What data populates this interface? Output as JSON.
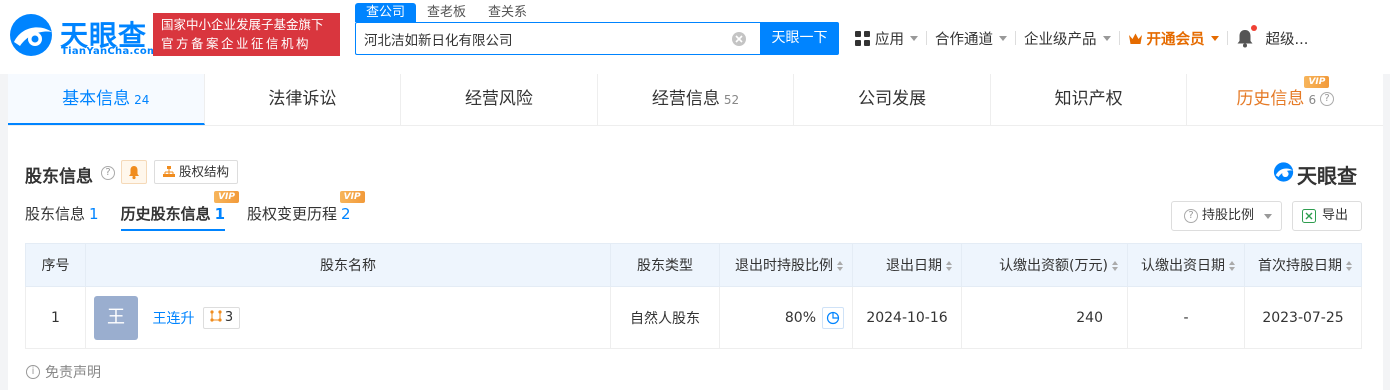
{
  "brand": {
    "name_cn": "天眼查",
    "name_en": "TianYanCha.com",
    "gov_line1": "国家中小企业发展子基金旗下",
    "gov_line2": "官方备案企业征信机构"
  },
  "search": {
    "tabs": [
      "查公司",
      "查老板",
      "查关系"
    ],
    "active_tab": "查公司",
    "query": "河北洁如新日化有限公司",
    "button": "天眼一下"
  },
  "nav": {
    "apps": "应用",
    "partner": "合作通道",
    "enterprise": "企业级产品",
    "vip": "开通会员",
    "user": "超级..."
  },
  "main_tabs": [
    {
      "label": "基本信息",
      "count": "24"
    },
    {
      "label": "法律诉讼",
      "count": ""
    },
    {
      "label": "经营风险",
      "count": ""
    },
    {
      "label": "经营信息",
      "count": "52"
    },
    {
      "label": "公司发展",
      "count": ""
    },
    {
      "label": "知识产权",
      "count": ""
    },
    {
      "label": "历史信息",
      "count": "6"
    }
  ],
  "vip_label": "VIP",
  "section": {
    "title": "股东信息",
    "equity_button": "股权结构",
    "sub_tabs": [
      {
        "label": "股东信息",
        "count": "1"
      },
      {
        "label": "历史股东信息",
        "count": "1"
      },
      {
        "label": "股权变更历程",
        "count": "2"
      }
    ],
    "ratio_button": "持股比例",
    "export_button": "导出"
  },
  "table": {
    "headers": [
      "序号",
      "股东名称",
      "股东类型",
      "退出时持股比例",
      "退出日期",
      "认缴出资额(万元)",
      "认缴出资日期",
      "首次持股日期"
    ],
    "rows": [
      {
        "index": "1",
        "avatar": "王",
        "name": "王连升",
        "relations": "3",
        "type": "自然人股东",
        "ratio": "80%",
        "exit_date": "2024-10-16",
        "amount": "240",
        "subscribe_date": "-",
        "first_date": "2023-07-25"
      }
    ]
  },
  "disclaimer": "免责声明",
  "colors": {
    "primary": "#0084ff",
    "gov_red": "#d9363e",
    "vip_orange": "#e56b00"
  }
}
